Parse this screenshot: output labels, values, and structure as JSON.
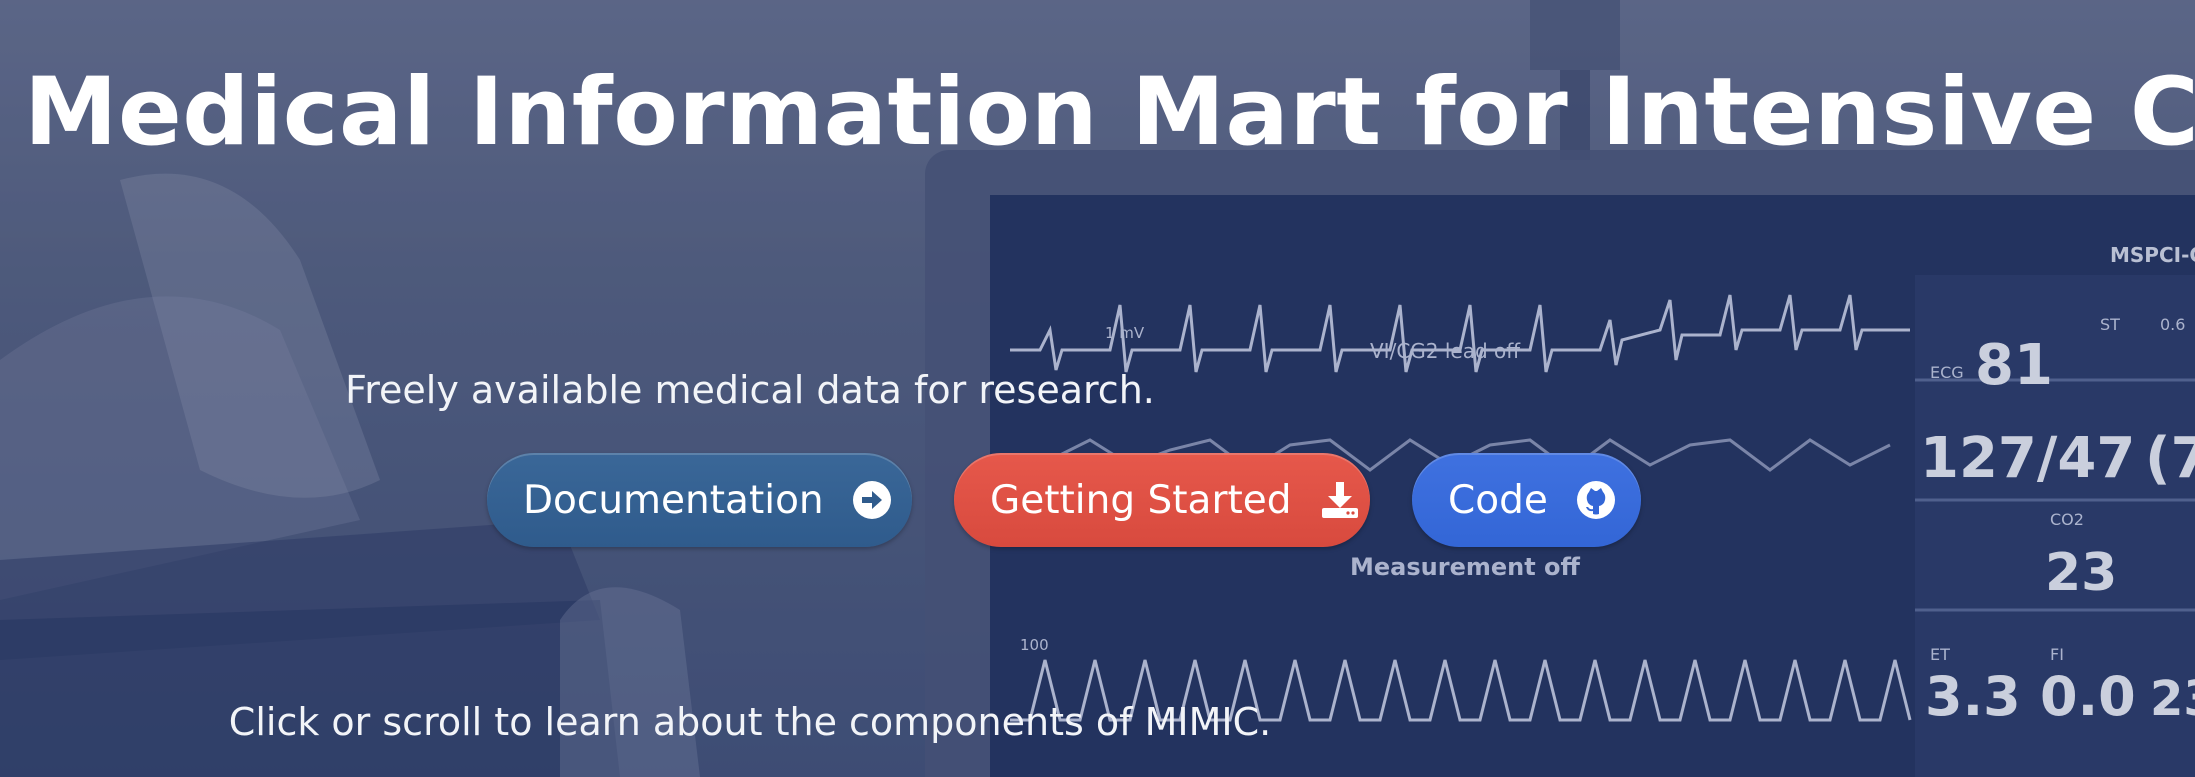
{
  "hero": {
    "title": "Medical Information Mart for Intensive Care",
    "subtitle": "Freely available medical data for research.",
    "footer": "Click or scroll to learn about the components of MIMIC."
  },
  "buttons": [
    {
      "label": "Documentation",
      "icon": "arrow-circle-right-icon",
      "color": "#2f5b8c"
    },
    {
      "label": "Getting Started",
      "icon": "download-icon",
      "color": "#d84a3e"
    },
    {
      "label": "Code",
      "icon": "github-icon",
      "color": "#3366d6"
    }
  ],
  "monitor": {
    "ecg_label": "ECG",
    "hr_value": "81",
    "bp_value": "127/47",
    "bp_partial": "(7",
    "co2_label": "CO2",
    "co2_value": "23",
    "et_label": "ET",
    "et_value": "3.3",
    "fi_label": "FI",
    "fi_value": "0.0",
    "st_value": "23",
    "st_label": "ST",
    "st_val2": "0.6",
    "measure_text": "Measurement off",
    "scale_label": "100",
    "channel_label": "VI/CG2 lead off",
    "mode_label": "MSPCI-C",
    "mv_label": "1 mV"
  }
}
